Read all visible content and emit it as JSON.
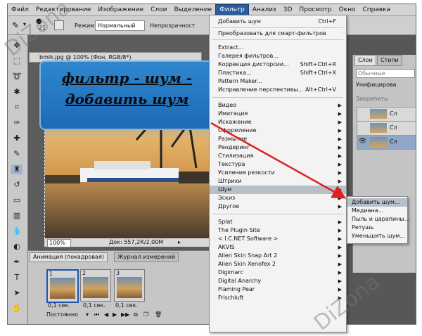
{
  "menubar": [
    "Файл",
    "Редактирование",
    "Изображение",
    "Слои",
    "Выделение",
    "Фильтр",
    "Анализ",
    "3D",
    "Просмотр",
    "Окно",
    "Справка"
  ],
  "menubar_active": "Фильтр",
  "options": {
    "mode_label": "Режим:",
    "mode_value": "Нормальный",
    "opacity_label": "Непрозрачност",
    "brush_size": "21"
  },
  "document": {
    "tab_title": "bmlk.jpg @ 100% (Фон, RGB/8*)",
    "zoom": "100%",
    "doc_size": "Док: 557,2К/2,00М"
  },
  "callout": {
    "line1": "фильтр - шум -",
    "line2": "добавить шум"
  },
  "filter_menu": {
    "top": [
      {
        "label": "Добавить шум",
        "shortcut": "Ctrl+F"
      },
      {
        "label": "Преобразовать для смарт-фильтров",
        "shortcut": ""
      }
    ],
    "group1": [
      {
        "label": "Extract...",
        "shortcut": ""
      },
      {
        "label": "Галерея фильтров...",
        "shortcut": ""
      },
      {
        "label": "Коррекция дисторсии...",
        "shortcut": "Shift+Ctrl+R"
      },
      {
        "label": "Пластика...",
        "shortcut": "Shift+Ctrl+X"
      },
      {
        "label": "Pattern Maker...",
        "shortcut": ""
      },
      {
        "label": "Исправление перспективы...",
        "shortcut": "Alt+Ctrl+V"
      }
    ],
    "group2": [
      "Видео",
      "Имитация",
      "Искажение",
      "Оформление",
      "Размытие",
      "Рендеринг",
      "Стилизация",
      "Текстура",
      "Усиление резкости",
      "Штрихи",
      "Шум",
      "Эскиз",
      "Другое"
    ],
    "highlighted": "Шум",
    "group3": [
      "Splat",
      "The Plugin Site",
      "< I.C.NET Software >",
      "AKVIS",
      "Alien Skin Snap Art 2",
      "Alien Skin Xenofex 2",
      "Digimarc",
      "Digital Anarchy",
      "Flaming Pear",
      "Frischluft"
    ]
  },
  "noise_submenu": {
    "items": [
      "Добавить шум...",
      "Медиана...",
      "Пыль и царапины...",
      "Ретушь",
      "Уменьшить шум..."
    ],
    "highlighted": "Добавить шум..."
  },
  "animation_panel": {
    "tab_active": "Анимация (покадровая)",
    "tab_other": "Журнал измерений",
    "frames": [
      {
        "num": "1",
        "time": "0,1 сек."
      },
      {
        "num": "2",
        "time": "0,1 сек."
      },
      {
        "num": "3",
        "time": "0,1 сек."
      }
    ],
    "loop": "Постоянно"
  },
  "layers_panel": {
    "tab_active": "Слои",
    "tab_other": "Стили",
    "blend": "Обычные",
    "unify": "Унифицирова",
    "lock": "Закрепить:",
    "layers": [
      "Сл",
      "Сл",
      "Сл"
    ]
  },
  "watermark": "DiZona",
  "colors": {
    "highlight": "#b7bfc9",
    "arrow": "#e0201f",
    "callout": "#1d6ab6",
    "menu_active": "#2b5d9e"
  }
}
